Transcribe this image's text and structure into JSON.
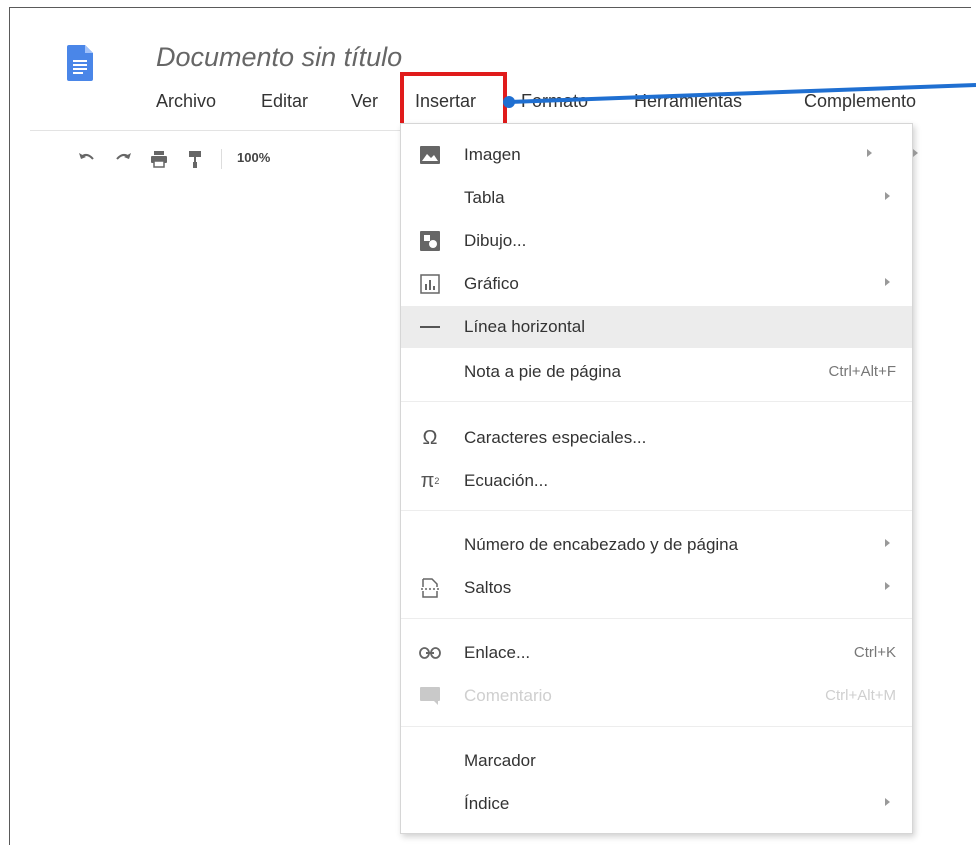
{
  "document": {
    "title": "Documento sin título"
  },
  "menubar": {
    "items": [
      "Archivo",
      "Editar",
      "Ver",
      "Insertar",
      "Formato",
      "Herramientas",
      "Complemento"
    ],
    "active": "Insertar"
  },
  "toolbar": {
    "zoom": "100%"
  },
  "insert_menu": {
    "items": [
      {
        "label": "Imagen",
        "icon": "image-icon",
        "submenu": true
      },
      {
        "label": "Tabla",
        "icon": "",
        "submenu": true
      },
      {
        "label": "Dibujo...",
        "icon": "drawing-icon",
        "submenu": false
      },
      {
        "label": "Gráfico",
        "icon": "chart-icon",
        "submenu": true
      },
      {
        "label": "Línea horizontal",
        "icon": "horizontal-line-icon",
        "submenu": false,
        "hovered": true
      },
      {
        "label": "Nota a pie de página",
        "icon": "",
        "shortcut": "Ctrl+Alt+F"
      },
      {
        "label": "Caracteres especiales...",
        "icon": "omega-icon"
      },
      {
        "label": "Ecuación...",
        "icon": "pi-icon"
      },
      {
        "label": "Número de encabezado y de página",
        "icon": "",
        "submenu": true
      },
      {
        "label": "Saltos",
        "icon": "page-break-icon",
        "submenu": true
      },
      {
        "label": "Enlace...",
        "icon": "link-icon",
        "shortcut": "Ctrl+K"
      },
      {
        "label": "Comentario",
        "icon": "comment-icon",
        "shortcut": "Ctrl+Alt+M",
        "disabled": true
      },
      {
        "label": "Marcador",
        "icon": ""
      },
      {
        "label": "Índice",
        "icon": "",
        "submenu": true
      }
    ]
  },
  "colors": {
    "highlight": "#e01b1b",
    "arrow": "#1f6fd1",
    "doc_icon": "#4a86e8"
  }
}
